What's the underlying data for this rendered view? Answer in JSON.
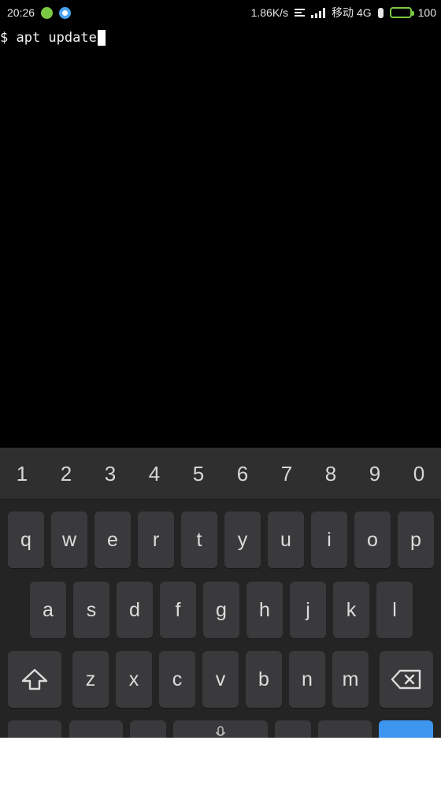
{
  "status_bar": {
    "time": "20:26",
    "speed": "1.86K/s",
    "carrier": "移动 4G",
    "battery": "100",
    "icons": [
      "app-notification-green-icon",
      "app-notification-blue-icon",
      "data-saver-icon",
      "signal-icon",
      "charging-icon",
      "battery-icon"
    ],
    "battery_level": 1.0,
    "colors": {
      "battery": "#7ac943",
      "green_icon": "#7ac943",
      "blue_icon": "#4aa3f0"
    }
  },
  "terminal": {
    "command": "$ apt update"
  },
  "keyboard": {
    "numbers": [
      "1",
      "2",
      "3",
      "4",
      "5",
      "6",
      "7",
      "8",
      "9",
      "0"
    ],
    "row1": [
      "q",
      "w",
      "e",
      "r",
      "t",
      "y",
      "u",
      "i",
      "o",
      "p"
    ],
    "row2": [
      "a",
      "s",
      "d",
      "f",
      "g",
      "h",
      "j",
      "k",
      "l"
    ],
    "row3": [
      "z",
      "x",
      "c",
      "v",
      "b",
      "n",
      "m"
    ],
    "special_icons": [
      "shift-icon",
      "backspace-icon",
      "microphone-icon"
    ],
    "colors": {
      "background": "#242424",
      "key": "#3a3a3c",
      "accent": "#3d95ef"
    }
  }
}
